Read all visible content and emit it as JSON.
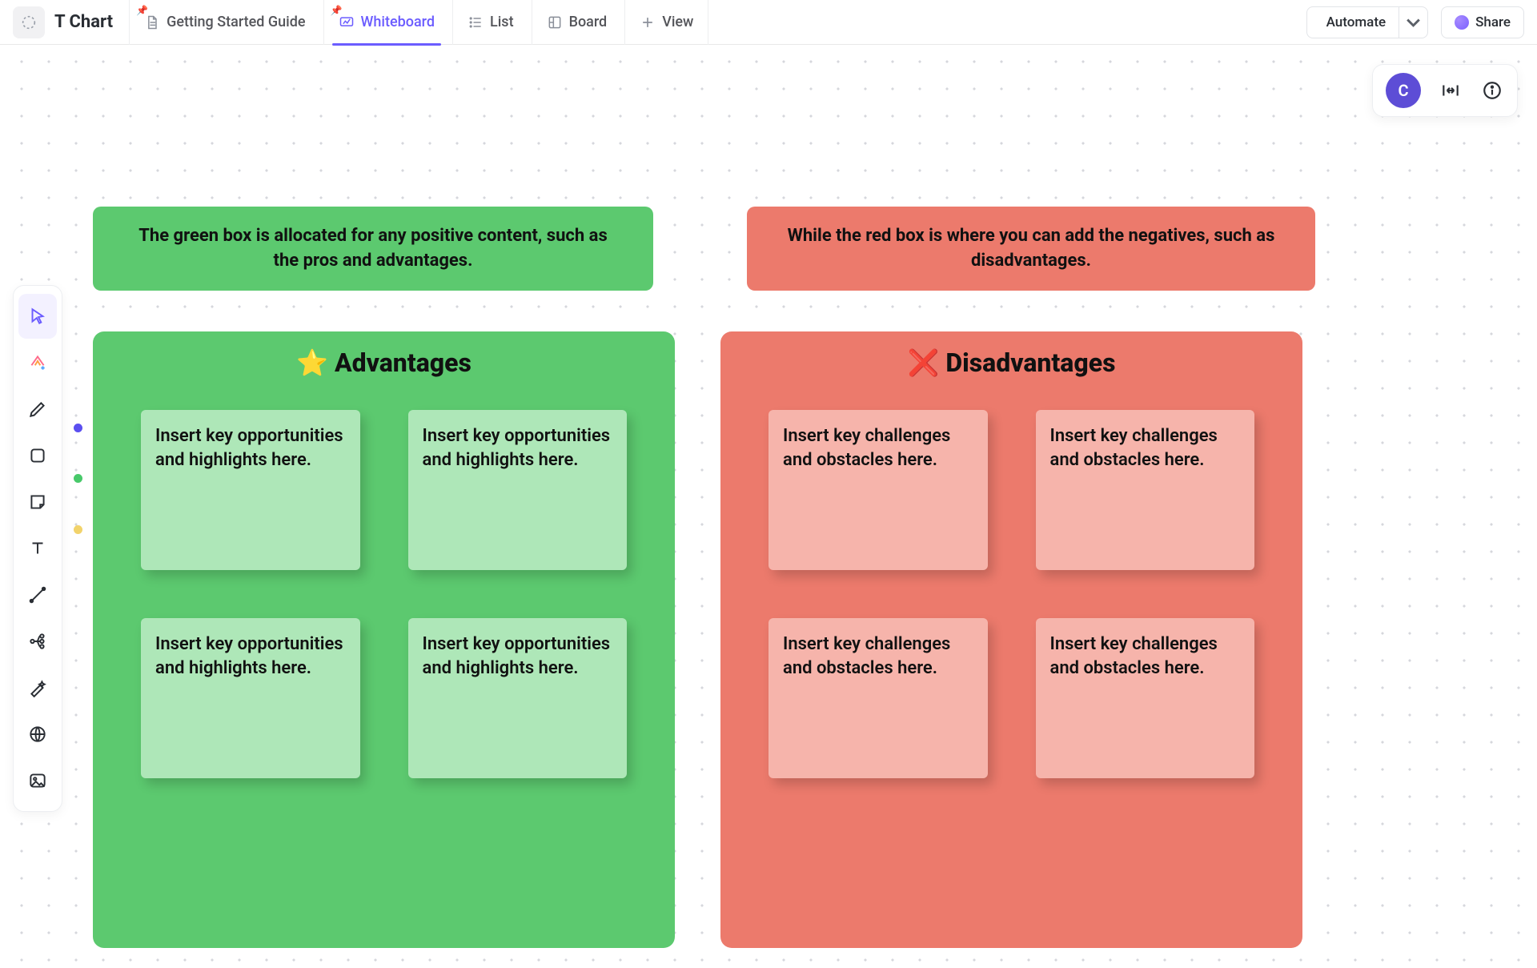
{
  "header": {
    "title": "T Chart",
    "tabs": [
      {
        "label": "Getting Started Guide"
      },
      {
        "label": "Whiteboard"
      },
      {
        "label": "List"
      },
      {
        "label": "Board"
      },
      {
        "label": "View"
      }
    ],
    "automate_label": "Automate",
    "share_label": "Share"
  },
  "floating": {
    "user_initial": "C"
  },
  "notes": {
    "green_header": "The green box is allocated for any positive content, such as the pros and advantages.",
    "red_header": "While the red box is where you can add the negatives, such as disadvantages."
  },
  "advantages": {
    "title": "Advantages",
    "icon": "⭐",
    "cards": [
      "Insert key opportunities and highlights here.",
      "Insert key opportunities and highlights here.",
      "Insert key opportunities and highlights here.",
      "Insert key opportunities and highlights here."
    ]
  },
  "disadvantages": {
    "title": "Disadvantages",
    "icon": "❌",
    "cards": [
      "Insert key challenges and obstacles here.",
      "Insert key challenges and obstacles here.",
      "Insert key challenges and obstacles here.",
      "Insert key challenges and obstacles here."
    ]
  },
  "tool_colors": {
    "pen": "#5b4ff0",
    "shape": "#48c96a",
    "sticky": "#f2d36b"
  }
}
